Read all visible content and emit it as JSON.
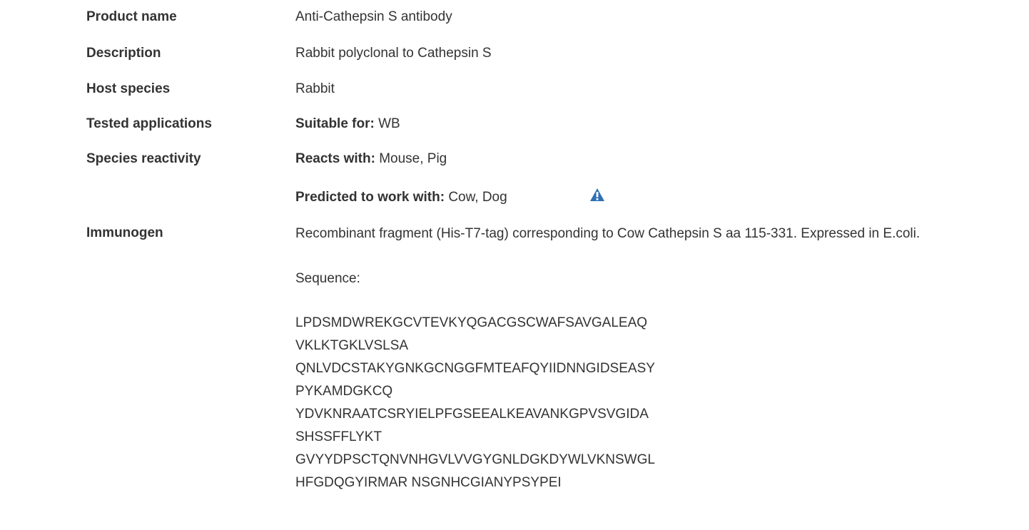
{
  "rows": {
    "product_name": {
      "label": "Product name",
      "value": "Anti-Cathepsin S antibody"
    },
    "description": {
      "label": "Description",
      "value": "Rabbit polyclonal to Cathepsin S"
    },
    "host_species": {
      "label": "Host species",
      "value": "Rabbit"
    },
    "tested_applications": {
      "label": "Tested applications",
      "prefix": "Suitable for:",
      "value": "WB"
    },
    "species_reactivity": {
      "label": "Species reactivity",
      "reacts_prefix": "Reacts with:",
      "reacts_value": "Mouse, Pig",
      "predicted_prefix": "Predicted to work with:",
      "predicted_value": "Cow, Dog",
      "icon": "warning-triangle-icon"
    },
    "immunogen": {
      "label": "Immunogen",
      "value": "Recombinant fragment (His-T7-tag) corresponding to Cow Cathepsin S aa 115-331. Expressed in E.coli.",
      "sequence_label": "Sequence:",
      "sequence": [
        "LPDSMDWREKGCVTEVKYQGACGSCWAFSAVGALEAQ",
        "VKLKTGKLVSLSA",
        "QNLVDCSTAKYGNKGCNGGFMTEAFQYIIDNNGIDSEASY",
        "PYKAMDGKCQ",
        "YDVKNRAATCSRYIELPFGSEEALKEAVANKGPVSVGIDA",
        "SHSSFFLYKT",
        "GVYYDPSCTQNVNHGVLVVGYGNLDGKDYWLVKNSWGL",
        "HFGDQGYIRMAR NSGNHCGIANYPSYPEI"
      ]
    }
  },
  "colors": {
    "text": "#333333",
    "icon": "#2f6fb3"
  }
}
